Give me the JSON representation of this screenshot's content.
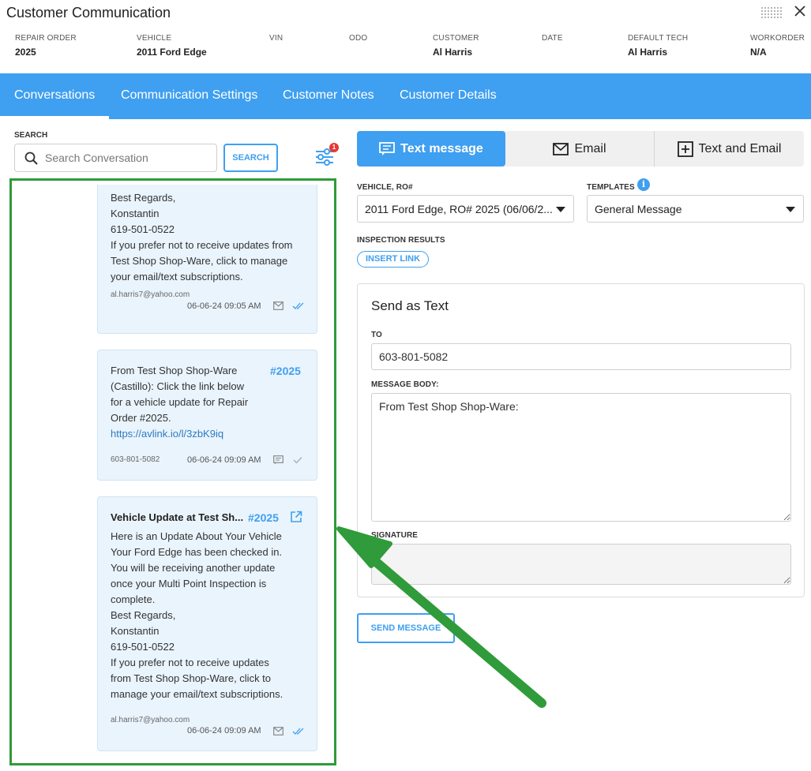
{
  "window": {
    "title": "Customer Communication"
  },
  "meta": [
    {
      "label": "REPAIR ORDER",
      "value": "2025"
    },
    {
      "label": "VEHICLE",
      "value": "2011 Ford Edge"
    },
    {
      "label": "VIN",
      "value": ""
    },
    {
      "label": "ODO",
      "value": ""
    },
    {
      "label": "CUSTOMER",
      "value": "Al Harris"
    },
    {
      "label": "DATE",
      "value": ""
    },
    {
      "label": "DEFAULT TECH",
      "value": "Al Harris"
    },
    {
      "label": "WORKORDER",
      "value": "N/A"
    }
  ],
  "tabs": [
    {
      "label": "Conversations",
      "active": true
    },
    {
      "label": "Communication Settings"
    },
    {
      "label": "Customer Notes"
    },
    {
      "label": "Customer Details"
    }
  ],
  "search": {
    "label": "SEARCH",
    "placeholder": "Search Conversation",
    "button": "SEARCH",
    "filter_badge": "1"
  },
  "conversations": [
    {
      "text": "Best Regards,\nKonstantin\n619-501-0522\nIf you prefer not to receive updates from Test Shop Shop-Ware, click to manage your email/text subscriptions.",
      "from": "al.harris7@yahoo.com",
      "time": "06-06-24 09:05 AM"
    },
    {
      "ro": "#2025",
      "text": "From Test Shop Shop-Ware\n(Castillo): Click the link below\nfor a vehicle update for Repair\nOrder #2025.",
      "link": "https://avlink.io/l/3zbK9iq",
      "from": "603-801-5082",
      "time": "06-06-24 09:09 AM"
    },
    {
      "title": "Vehicle Update at Test Sh...",
      "ro": "#2025",
      "text": "Here is an Update About Your Vehicle\nYour Ford Edge has been checked in.\nYou will be receiving another update\nonce your Multi Point Inspection is\ncomplete.\nBest Regards,\nKonstantin\n619-501-0522\nIf you prefer not to receive updates\nfrom Test Shop Shop-Ware, click to\nmanage your email/text subscriptions.",
      "from": "al.harris7@yahoo.com",
      "time": "06-06-24 09:09 AM"
    }
  ],
  "compose": {
    "modes": [
      {
        "label": "Text message",
        "icon": "message-icon",
        "active": true
      },
      {
        "label": "Email",
        "icon": "mail-icon"
      },
      {
        "label": "Text and Email",
        "icon": "plus-box-icon"
      }
    ],
    "vehicle_label": "VEHICLE, RO#",
    "vehicle_value": "2011 Ford Edge, RO# 2025 (06/06/2...",
    "templates_label": "TEMPLATES",
    "templates_value": "General Message",
    "inspection_label": "INSPECTION RESULTS",
    "insert_link": "INSERT LINK",
    "card_title": "Send as Text",
    "to_label": "TO",
    "to_value": "603-801-5082",
    "body_label": "MESSAGE BODY:",
    "body_value": "From Test Shop Shop-Ware:",
    "signature_label": "SIGNATURE",
    "signature_value": "",
    "send_button": "SEND MESSAGE"
  },
  "colors": {
    "accent": "#3f9ff0",
    "highlight_frame": "#2f9b3a",
    "arrow": "#2f9b3a",
    "badge": "#e53935"
  }
}
